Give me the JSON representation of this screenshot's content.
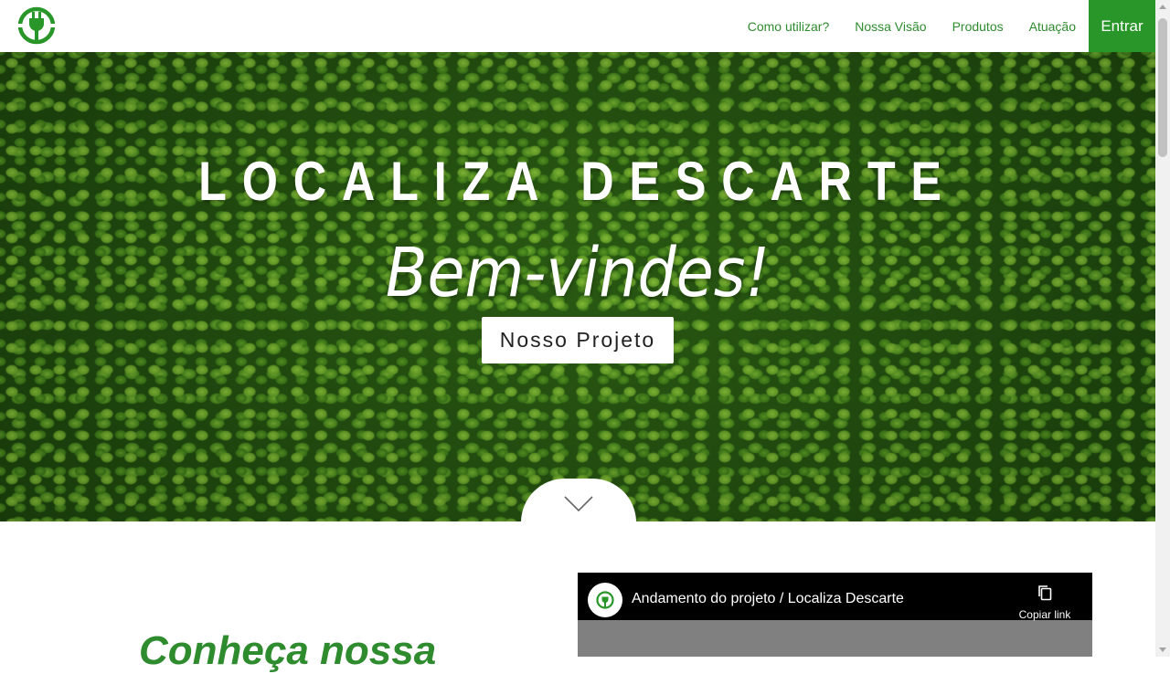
{
  "nav": {
    "links": [
      "Como utilizar?",
      "Nossa Visão",
      "Produtos",
      "Atuação"
    ],
    "login_label": "Entrar"
  },
  "colors": {
    "brand_green": "#289628",
    "link_green": "#2e8b2e"
  },
  "hero": {
    "title": "LOCALIZA DESCARTE",
    "subtitle": "Bem-vindes!",
    "button_label": "Nosso Projeto",
    "scroll_icon": "chevron-down-icon"
  },
  "about": {
    "heading": "Conheça nossa"
  },
  "video": {
    "title": "Andamento do projeto / Localiza Descarte",
    "copy_label": "Copiar link",
    "copy_icon": "copy-icon"
  }
}
